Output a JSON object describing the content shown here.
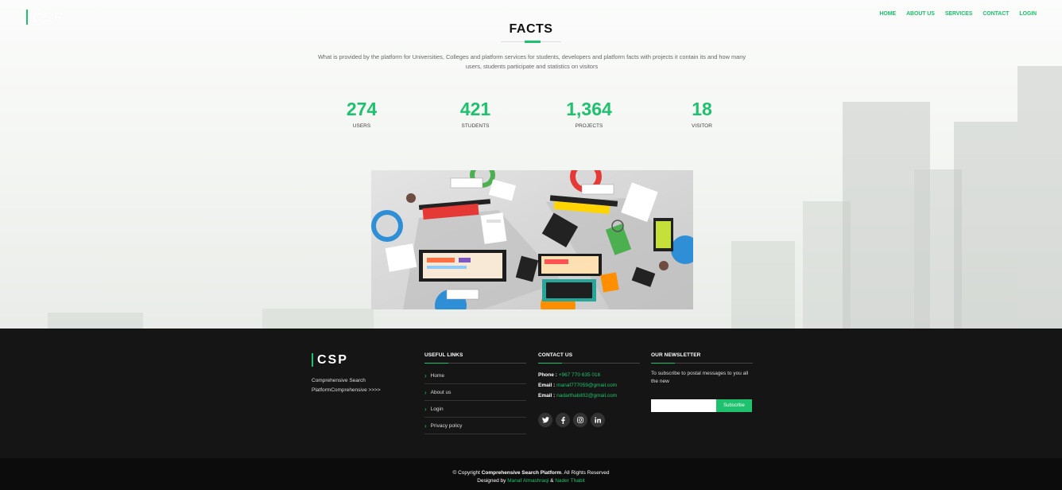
{
  "brand": "CSP",
  "nav": [
    "HOME",
    "ABOUT US",
    "SERVICES",
    "CONTACT",
    "LOGIN"
  ],
  "facts": {
    "title": "FACTS",
    "description": "What is provided by the platform for Universities, Colleges and platform services for students, developers and platform facts with projects it contain its and how many users, students participate and statistics on visitors",
    "counters": [
      {
        "value": "274",
        "label": "USERS"
      },
      {
        "value": "421",
        "label": "STUDENTS"
      },
      {
        "value": "1,364",
        "label": "PROJECTS"
      },
      {
        "value": "18",
        "label": "VISITOR"
      }
    ]
  },
  "footer": {
    "brand": "CSP",
    "about": "Comprehensive Search PlatformComprehensive >>>>",
    "links_title": "USEFUL LINKS",
    "links": [
      "Home",
      "About us",
      "Login",
      "Privacy policy"
    ],
    "contact_title": "CONTACT US",
    "phone_label": "Phone :",
    "phone": "+967 770 635 016",
    "email_label": "Email :",
    "email1": "manaf777059@gmail.com",
    "email2": "nadarthabit02@gmail.com",
    "socials": [
      "twitter-icon",
      "facebook-icon",
      "instagram-icon",
      "linkedin-icon"
    ],
    "news_title": "OUR NEWSLETTER",
    "news_text": "To subscribe to postal messages to you all the new",
    "subscribe": "Subscribe"
  },
  "copyright": {
    "prefix": "© Copyright",
    "name": "Comprehensive Search Platform",
    "suffix": ". All Rights Reserved",
    "designed_by": "Designed by",
    "author1": "Manaf Almashraqi",
    "amp": "&",
    "author2": "Nader Thabit"
  },
  "colors": {
    "accent": "#1ec16d",
    "footer_bg": "#151515"
  }
}
